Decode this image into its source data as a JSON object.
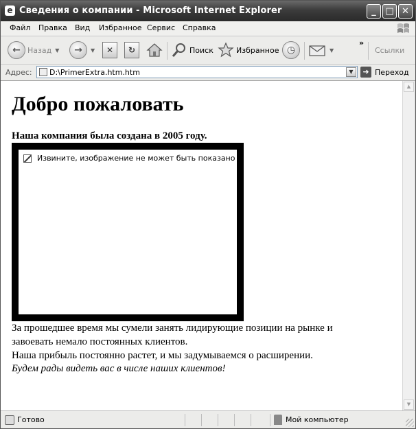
{
  "window": {
    "title": "Сведения о компании - Microsoft Internet Explorer"
  },
  "menu": {
    "items": [
      "Файл",
      "Правка",
      "Вид",
      "Избранное",
      "Сервис",
      "Справка"
    ]
  },
  "toolbar": {
    "back": "Назад",
    "search": "Поиск",
    "favorites": "Избранное",
    "links": "Ссылки",
    "more": "»"
  },
  "address": {
    "label": "Адрес:",
    "url": "D:\\PrimerExtra.htm.htm",
    "go": "Переход"
  },
  "content": {
    "heading": "Добро пожаловать",
    "subheading": "Наша компания была создана в 2005 году.",
    "image_alt": "Извините, изображение не может быть показано",
    "paragraphs": [
      "За прошедшее время мы сумели занять лидирующие позиции на рынке и",
      "завоевать немало постоянных клиентов.",
      "Наша прибыль постоянно растет, и мы задумываемся о расширении."
    ],
    "closing": "Будем рады видеть вас в числе наших клиентов!"
  },
  "status": {
    "text": "Готово",
    "zone": "Мой компьютер"
  }
}
